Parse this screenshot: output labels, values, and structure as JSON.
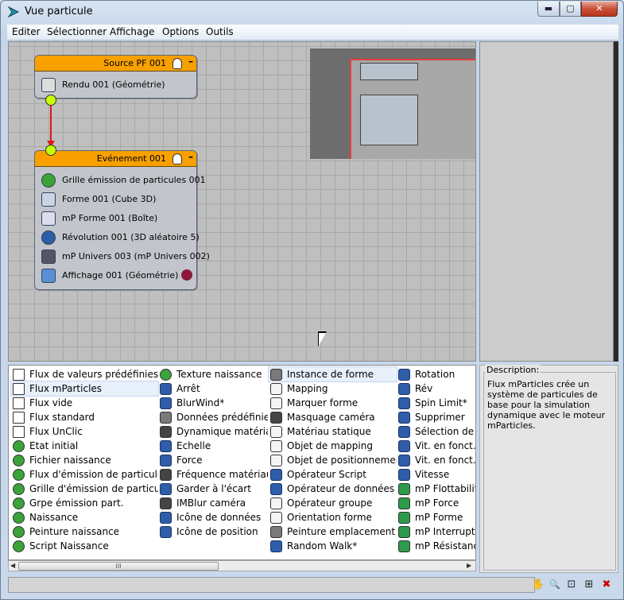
{
  "window": {
    "title": "Vue particule",
    "min_label": "▬",
    "max_label": "▢",
    "close_label": "✕"
  },
  "menu": [
    "Editer",
    "Sélectionner",
    "Affichage",
    "Options",
    "Outils"
  ],
  "graph": {
    "source_node": {
      "title": "Source PF 001",
      "minus": "–",
      "operators": [
        "Rendu 001 (Géométrie)"
      ]
    },
    "event_node": {
      "title": "Evénement 001",
      "minus": "–",
      "operators": [
        "Grille émission de particules 001",
        "Forme 001 (Cube 3D)",
        "mP Forme 001 (Boîte)",
        "Révolution 001 (3D aléatoire 5)",
        "mP Univers 003 (mP Univers 002)",
        "Affichage 001 (Géométrie)"
      ],
      "display_color": "#8b1a3a"
    }
  },
  "depot": {
    "col1": [
      "Flux de valeurs prédéfinies",
      "Flux mParticles",
      "Flux vide",
      "Flux standard",
      "Flux UnClic",
      "Etat initial",
      "Fichier naissance",
      "Flux d'émission de particules",
      "Grille d'émission de particules",
      "Grpe émission part.",
      "Naissance",
      "Peinture naissance",
      "Script Naissance"
    ],
    "col2": [
      "Texture naissance",
      "Arrêt",
      "BlurWind*",
      "Données prédéfinies",
      "Dynamique matériau",
      "Echelle",
      "Force",
      "Fréquence matériau",
      "Garder à l'écart",
      "IMBlur caméra",
      "Icône de données",
      "Icône de position"
    ],
    "col3": [
      "Instance de forme",
      "Mapping",
      "Marquer forme",
      "Masquage caméra",
      "Matériau statique",
      "Objet de mapping",
      "Objet de positionnement",
      "Opérateur Script",
      "Opérateur de données",
      "Opérateur groupe",
      "Orientation forme",
      "Peinture emplacement",
      "Random Walk*"
    ],
    "col4": [
      "Rotation",
      "Rév",
      "Spin Limit*",
      "Supprimer",
      "Sélection de gr",
      "Vit. en fonct. d",
      "Vit. en fonct. d",
      "Vitesse",
      "mP Flottabilité",
      "mP Force",
      "mP Forme",
      "mP Interrupteu",
      "mP Résistance"
    ]
  },
  "scrollbar": {
    "left_arrow": "◀",
    "right_arrow": "▶",
    "grip": "III"
  },
  "description": {
    "heading": "Description:",
    "text": "Flux mParticles crée un système de particules de base pour la simulation dynamique avec le moteur mParticles."
  },
  "tools": {
    "pan": "✋",
    "zoom": "🔍",
    "zoom_region": "⊡",
    "zoom_extents": "⊞",
    "no_display": "✖"
  }
}
